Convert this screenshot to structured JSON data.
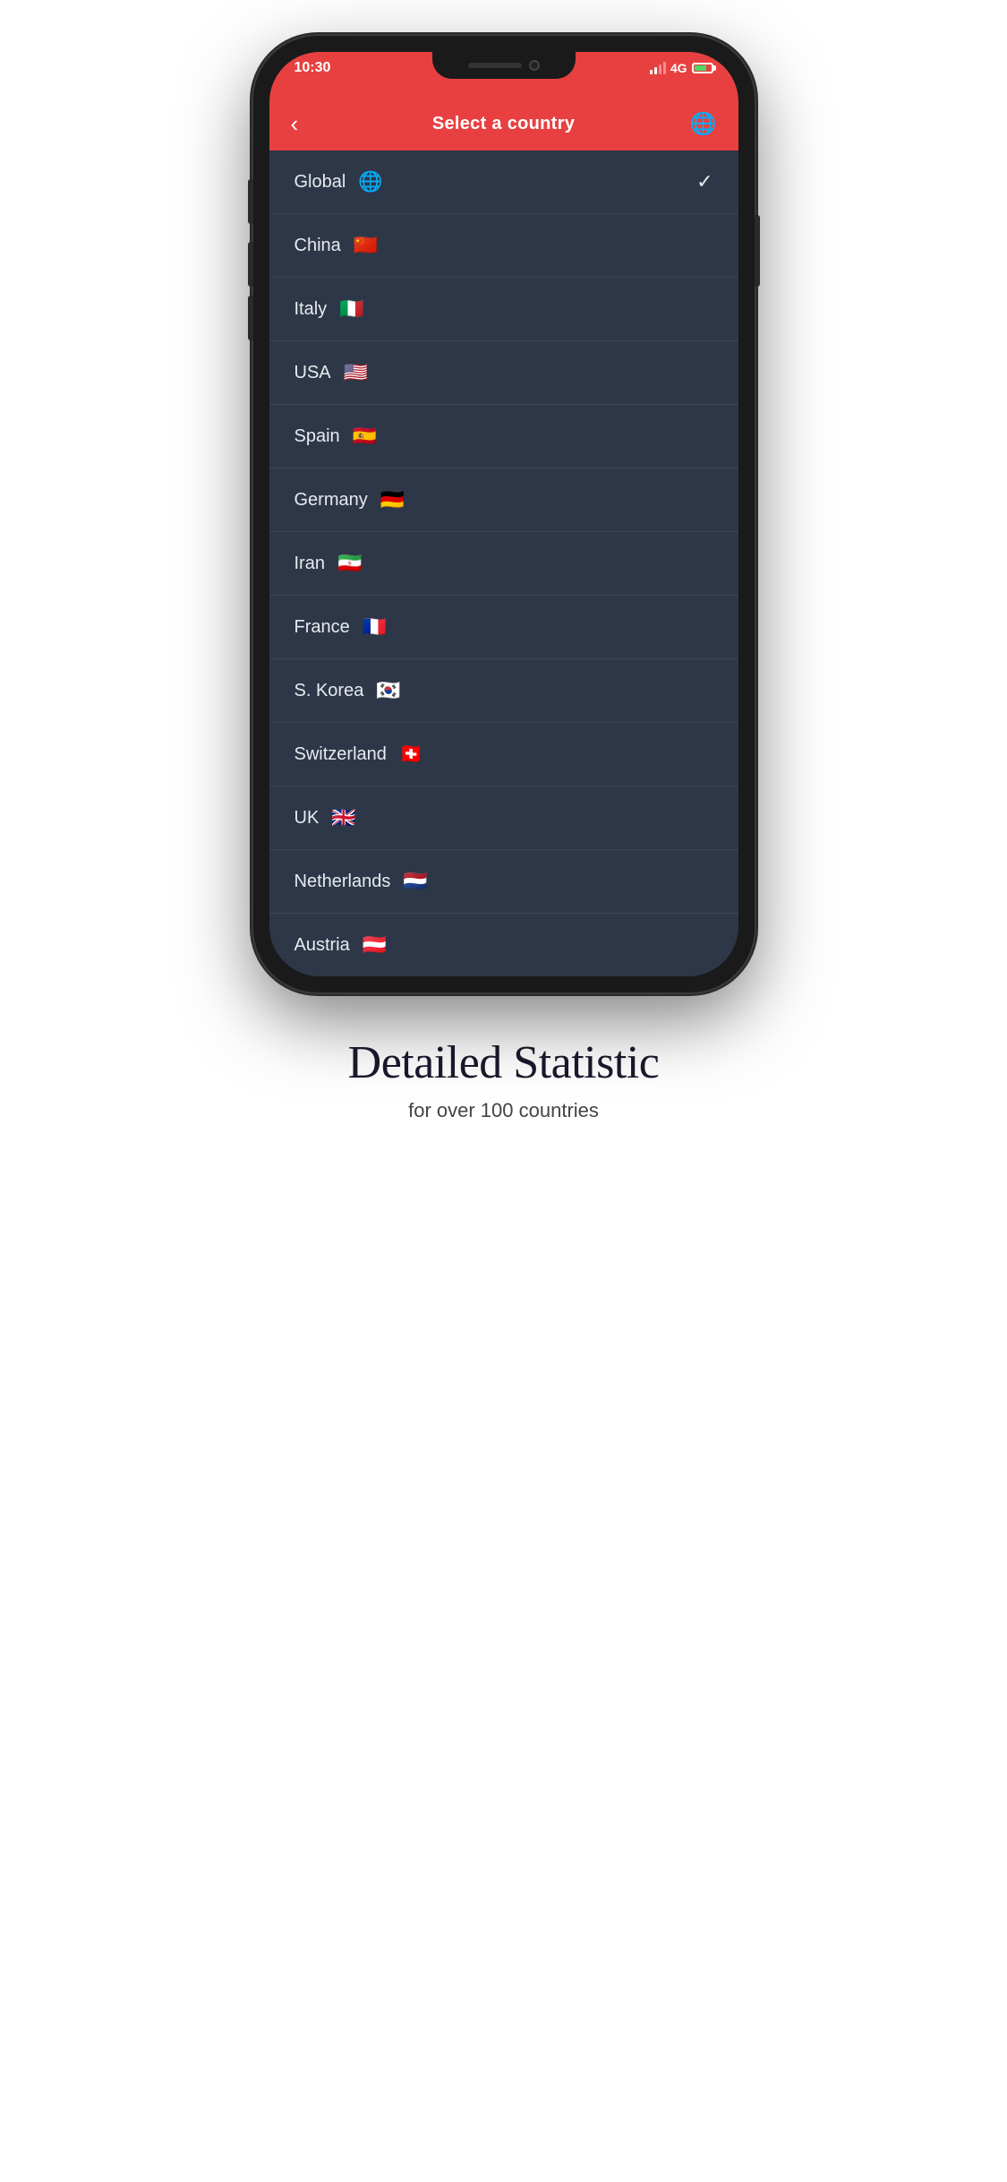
{
  "status_bar": {
    "time": "10:30",
    "network": "4G"
  },
  "nav": {
    "title": "Select a country",
    "back_label": "‹",
    "globe_label": "🌐"
  },
  "countries": [
    {
      "name": "Global",
      "flag": "🌐",
      "selected": true
    },
    {
      "name": "China",
      "flag": "🇨🇳",
      "selected": false
    },
    {
      "name": "Italy",
      "flag": "🇮🇹",
      "selected": false
    },
    {
      "name": "USA",
      "flag": "🇺🇸",
      "selected": false
    },
    {
      "name": "Spain",
      "flag": "🇪🇸",
      "selected": false
    },
    {
      "name": "Germany",
      "flag": "🇩🇪",
      "selected": false
    },
    {
      "name": "Iran",
      "flag": "🇮🇷",
      "selected": false
    },
    {
      "name": "France",
      "flag": "🇫🇷",
      "selected": false
    },
    {
      "name": "S. Korea",
      "flag": "🇰🇷",
      "selected": false
    },
    {
      "name": "Switzerland",
      "flag": "🇨🇭",
      "selected": false
    },
    {
      "name": "UK",
      "flag": "🇬🇧",
      "selected": false
    },
    {
      "name": "Netherlands",
      "flag": "🇳🇱",
      "selected": false
    },
    {
      "name": "Austria",
      "flag": "🇦🇹",
      "selected": false
    }
  ],
  "bottom": {
    "title": "Detailed Statistic",
    "subtitle": "for over 100 countries"
  }
}
